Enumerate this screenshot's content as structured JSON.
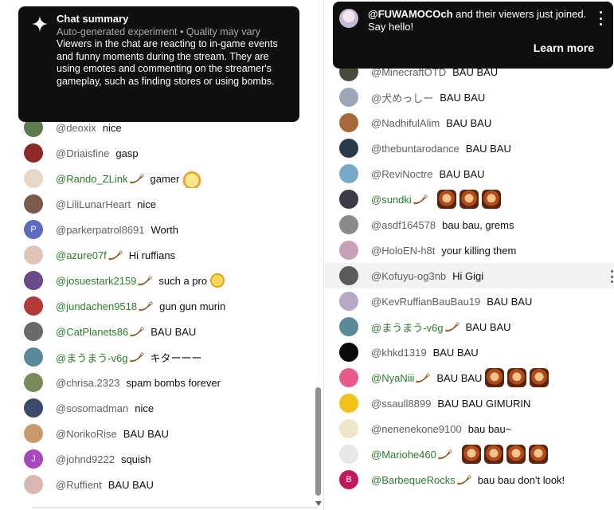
{
  "summary": {
    "title": "Chat summary",
    "subtitle": "Auto-generated experiment • Quality may vary",
    "body": "Viewers in the chat are reacting to in-game events and funny moments during the stream. They are using emotes and commenting on the streamer's gameplay, such as finding stores or using bombs."
  },
  "notification": {
    "channel": "@FUWAMOCOch",
    "message": " and their viewers just joined. Say hello!",
    "action": "Learn more"
  },
  "left_messages": [
    {
      "author": "@deoxix",
      "text": "nice",
      "member": false,
      "avatar_color": "#5c7a4e",
      "emotes": []
    },
    {
      "author": "@Driaisfine",
      "text": "gasp",
      "member": false,
      "avatar_color": "#8c2a2a",
      "emotes": []
    },
    {
      "author": "@Rando_ZLink",
      "text": "gamer",
      "member": true,
      "avatar_color": "#e8d8c8",
      "emotes": [
        "pudding"
      ]
    },
    {
      "author": "@LiliLunarHeart",
      "text": "nice",
      "member": false,
      "avatar_color": "#7a5a48",
      "emotes": []
    },
    {
      "author": "@parkerpatrol8691",
      "text": "Worth",
      "member": false,
      "avatar_color": "#5c6bc0",
      "initial": "P",
      "emotes": []
    },
    {
      "author": "@azure07f",
      "text": "Hi ruffians",
      "member": true,
      "avatar_color": "#e0c4b8",
      "emotes": []
    },
    {
      "author": "@josuestark2159",
      "text": "such a pro",
      "member": true,
      "avatar_color": "#6a4a8a",
      "emotes": [
        "chick"
      ]
    },
    {
      "author": "@jundachen9518",
      "text": "gun gun murin",
      "member": true,
      "avatar_color": "#b23a3a",
      "emotes": []
    },
    {
      "author": "@CatPlanets86",
      "text": "BAU BAU",
      "member": true,
      "avatar_color": "#6a6a6a",
      "emotes": []
    },
    {
      "author": "@まうまう-v6g",
      "text": "キターーー",
      "member": true,
      "avatar_color": "#5a8a9a",
      "emotes": []
    },
    {
      "author": "@chrisa.2323",
      "text": "spam bombs forever",
      "member": false,
      "avatar_color": "#7a8a5a",
      "emotes": []
    },
    {
      "author": "@sosomadman",
      "text": "nice",
      "member": false,
      "avatar_color": "#3a4a6a",
      "emotes": []
    },
    {
      "author": "@NorikoRise",
      "text": "BAU BAU",
      "member": false,
      "avatar_color": "#c89a6a",
      "emotes": []
    },
    {
      "author": "@johnd9222",
      "text": "squish",
      "member": false,
      "avatar_color": "#ab47bc",
      "initial": "J",
      "emotes": []
    },
    {
      "author": "@Ruffient",
      "text": "BAU BAU",
      "member": false,
      "avatar_color": "#d8b8b0",
      "emotes": []
    }
  ],
  "right_messages": [
    {
      "author": "@MinecraftOTD",
      "text": "BAU BAU",
      "member": false,
      "avatar_color": "#4a4a3a",
      "emotes": []
    },
    {
      "author": "@犬めっしー",
      "text": "BAU BAU",
      "member": false,
      "avatar_color": "#9aa8b8",
      "emotes": []
    },
    {
      "author": "@NadhifulAlim",
      "text": "BAU BAU",
      "member": false,
      "avatar_color": "#a86a3a",
      "emotes": []
    },
    {
      "author": "@thebuntarodance",
      "text": "BAU BAU",
      "member": false,
      "avatar_color": "#2a3a4a",
      "emotes": []
    },
    {
      "author": "@ReviNoctre",
      "text": "BAU BAU",
      "member": false,
      "avatar_color": "#7aa8c8",
      "emotes": []
    },
    {
      "author": "@sundki",
      "text": "",
      "member": true,
      "avatar_color": "#3a3a4a",
      "emotes": [
        "fox",
        "fox",
        "fox"
      ]
    },
    {
      "author": "@asdf164578",
      "text": "bau bau, grems",
      "member": false,
      "avatar_color": "#8a8a8a",
      "emotes": []
    },
    {
      "author": "@HoloEN-h8t",
      "text": "your killing them",
      "member": false,
      "avatar_color": "#c8a0b8",
      "emotes": []
    },
    {
      "author": "@Kofuyu-og3nb",
      "text": "Hi Gigi",
      "member": false,
      "avatar_color": "#5a5a5a",
      "emotes": [],
      "highlight": true
    },
    {
      "author": "@KevRuffianBauBau19",
      "text": "BAU BAU",
      "member": false,
      "avatar_color": "#b8a8c8",
      "emotes": []
    },
    {
      "author": "@まうまう-v6g",
      "text": "BAU BAU",
      "member": true,
      "avatar_color": "#5a8a9a",
      "emotes": []
    },
    {
      "author": "@khkd1319",
      "text": "BAU BAU",
      "member": false,
      "avatar_color": "#0a0a0a",
      "emotes": []
    },
    {
      "author": "@NyaNiii",
      "text": "BAU BAU",
      "member": true,
      "avatar_color": "#e85a8a",
      "emotes": [
        "fox",
        "fox",
        "fox"
      ]
    },
    {
      "author": "@ssaull8899",
      "text": "BAU BAU GIMURIN",
      "member": false,
      "avatar_color": "#f2c21a",
      "emotes": []
    },
    {
      "author": "@nenenekone9100",
      "text": "bau bau~",
      "member": false,
      "avatar_color": "#f2e6c8",
      "emotes": []
    },
    {
      "author": "@Mariohe460",
      "text": "",
      "member": true,
      "avatar_color": "#e8e8e8",
      "emotes": [
        "fox",
        "fox",
        "fox",
        "fox"
      ]
    },
    {
      "author": "@BarbequeRocks",
      "text": "bau bau don't look!",
      "member": true,
      "avatar_color": "#c2185b",
      "initial": "B",
      "emotes": []
    }
  ]
}
